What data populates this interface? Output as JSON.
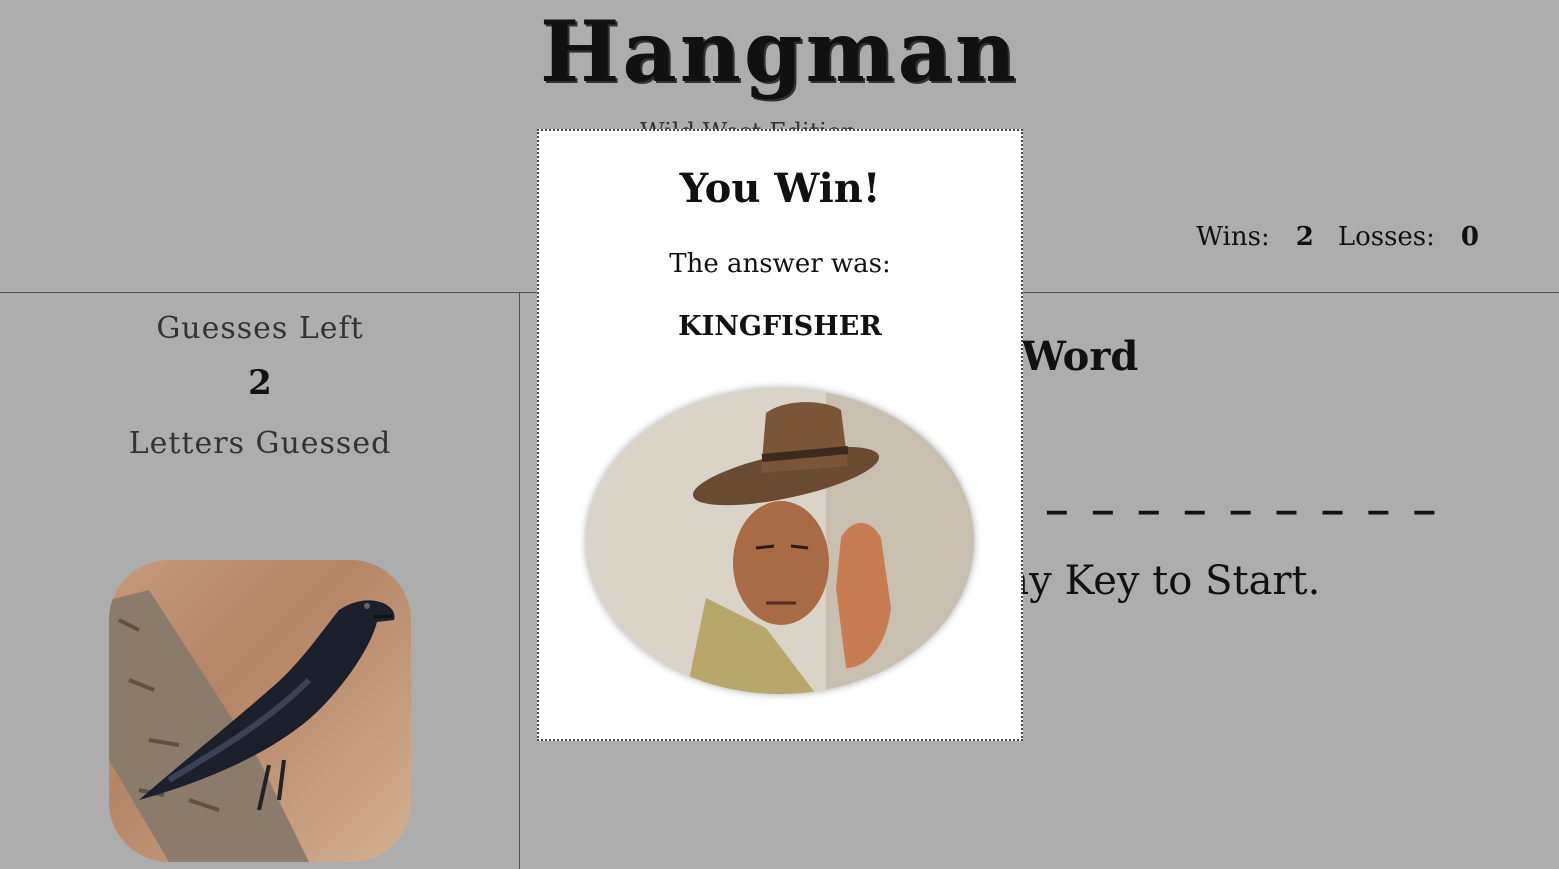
{
  "game": {
    "title": "Hangman",
    "subtitle": "Wild West Edition"
  },
  "score": {
    "wins_label": "Wins:",
    "wins": "2",
    "losses_label": "Losses:",
    "losses": "0"
  },
  "left": {
    "guesses_label": "Guesses Left",
    "guesses_left": "2",
    "letters_label": "Letters Guessed",
    "image_icon": "crow-image"
  },
  "right": {
    "current_word_label": "Current Word",
    "word_blanks": "_ _ _ _ _ _ _ _ _ _",
    "press_key": "Press Any Key to Start."
  },
  "modal": {
    "title": "You Win!",
    "subtitle": "The answer was:",
    "answer": "KINGFISHER",
    "image_icon": "cowboy-image"
  }
}
